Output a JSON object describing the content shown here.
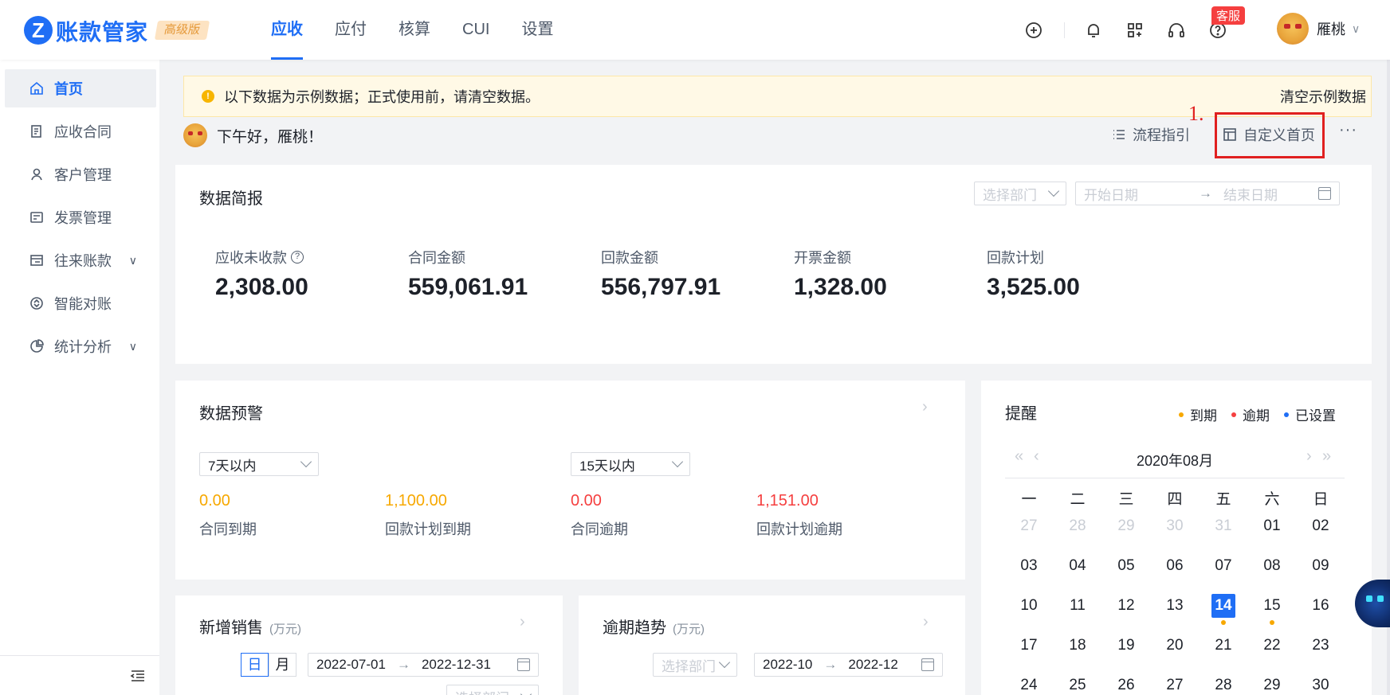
{
  "brand": {
    "logo_letter": "Z",
    "name": "账款管家",
    "edition": "高级版",
    "color": "#1f6ef5"
  },
  "nav": [
    "应收",
    "应付",
    "核算",
    "CUI",
    "设置"
  ],
  "top_icons": [
    "plus-circle-icon",
    "bell-icon",
    "grid-icon",
    "headset-icon",
    "help-icon"
  ],
  "kefu_badge": "客服",
  "user": {
    "name": "雁桃"
  },
  "sidebar": {
    "items": [
      {
        "label": "首页",
        "icon": "home-icon",
        "active": true
      },
      {
        "label": "应收合同",
        "icon": "contract-icon"
      },
      {
        "label": "客户管理",
        "icon": "user-icon"
      },
      {
        "label": "发票管理",
        "icon": "invoice-icon"
      },
      {
        "label": "往来账款",
        "icon": "ledger-icon",
        "expandable": true
      },
      {
        "label": "智能对账",
        "icon": "reconcile-icon"
      },
      {
        "label": "统计分析",
        "icon": "pie-chart-icon",
        "expandable": true
      }
    ]
  },
  "notice": {
    "text": "以下数据为示例数据；正式使用前，请清空数据。",
    "action": "清空示例数据"
  },
  "greeting": "下午好，雁桃！",
  "actions": {
    "guide": "流程指引",
    "customize": "自定义首页",
    "more": "···",
    "step_label": "1."
  },
  "summary": {
    "title": "数据简报",
    "dept_placeholder": "选择部门",
    "start_placeholder": "开始日期",
    "end_placeholder": "结束日期",
    "stats": [
      {
        "label": "应收未收款",
        "value": "2,308.00",
        "help": "?"
      },
      {
        "label": "合同金额",
        "value": "559,061.91"
      },
      {
        "label": "回款金额",
        "value": "556,797.91"
      },
      {
        "label": "开票金额",
        "value": "1,328.00"
      },
      {
        "label": "回款计划",
        "value": "3,525.00"
      }
    ]
  },
  "warning": {
    "title": "数据预警",
    "select1": "7天以内",
    "select2": "15天以内",
    "items": [
      {
        "value": "0.00",
        "label": "合同到期",
        "color": "#f7a800"
      },
      {
        "value": "1,100.00",
        "label": "回款计划到期",
        "color": "#f7a800"
      },
      {
        "value": "0.00",
        "label": "合同逾期",
        "color": "#f53f3f"
      },
      {
        "value": "1,151.00",
        "label": "回款计划逾期",
        "color": "#f53f3f"
      }
    ]
  },
  "reminder": {
    "title": "提醒",
    "legend": [
      {
        "label": "到期",
        "color": "#f7a800"
      },
      {
        "label": "逾期",
        "color": "#f53f3f"
      },
      {
        "label": "已设置",
        "color": "#1f6ef5"
      }
    ],
    "month": "2020年08月",
    "weekdays": [
      "一",
      "二",
      "三",
      "四",
      "五",
      "六",
      "日"
    ],
    "weeks": [
      [
        "27",
        "28",
        "29",
        "30",
        "31",
        "01",
        "02"
      ],
      [
        "03",
        "04",
        "05",
        "06",
        "07",
        "08",
        "09"
      ],
      [
        "10",
        "11",
        "12",
        "13",
        "14",
        "15",
        "16"
      ],
      [
        "17",
        "18",
        "19",
        "20",
        "21",
        "22",
        "23"
      ],
      [
        "24",
        "25",
        "26",
        "27",
        "28",
        "29",
        "30"
      ]
    ],
    "today": "14"
  },
  "new_sales": {
    "title": "新增销售",
    "unit": "(万元)",
    "seg": [
      "日",
      "月"
    ],
    "start": "2022-07-01",
    "end": "2022-12-31",
    "dept_placeholder": "选择部门"
  },
  "overdue_trend": {
    "title": "逾期趋势",
    "unit": "(万元)",
    "dept_placeholder": "选择部门",
    "start": "2022-10",
    "end": "2022-12"
  }
}
